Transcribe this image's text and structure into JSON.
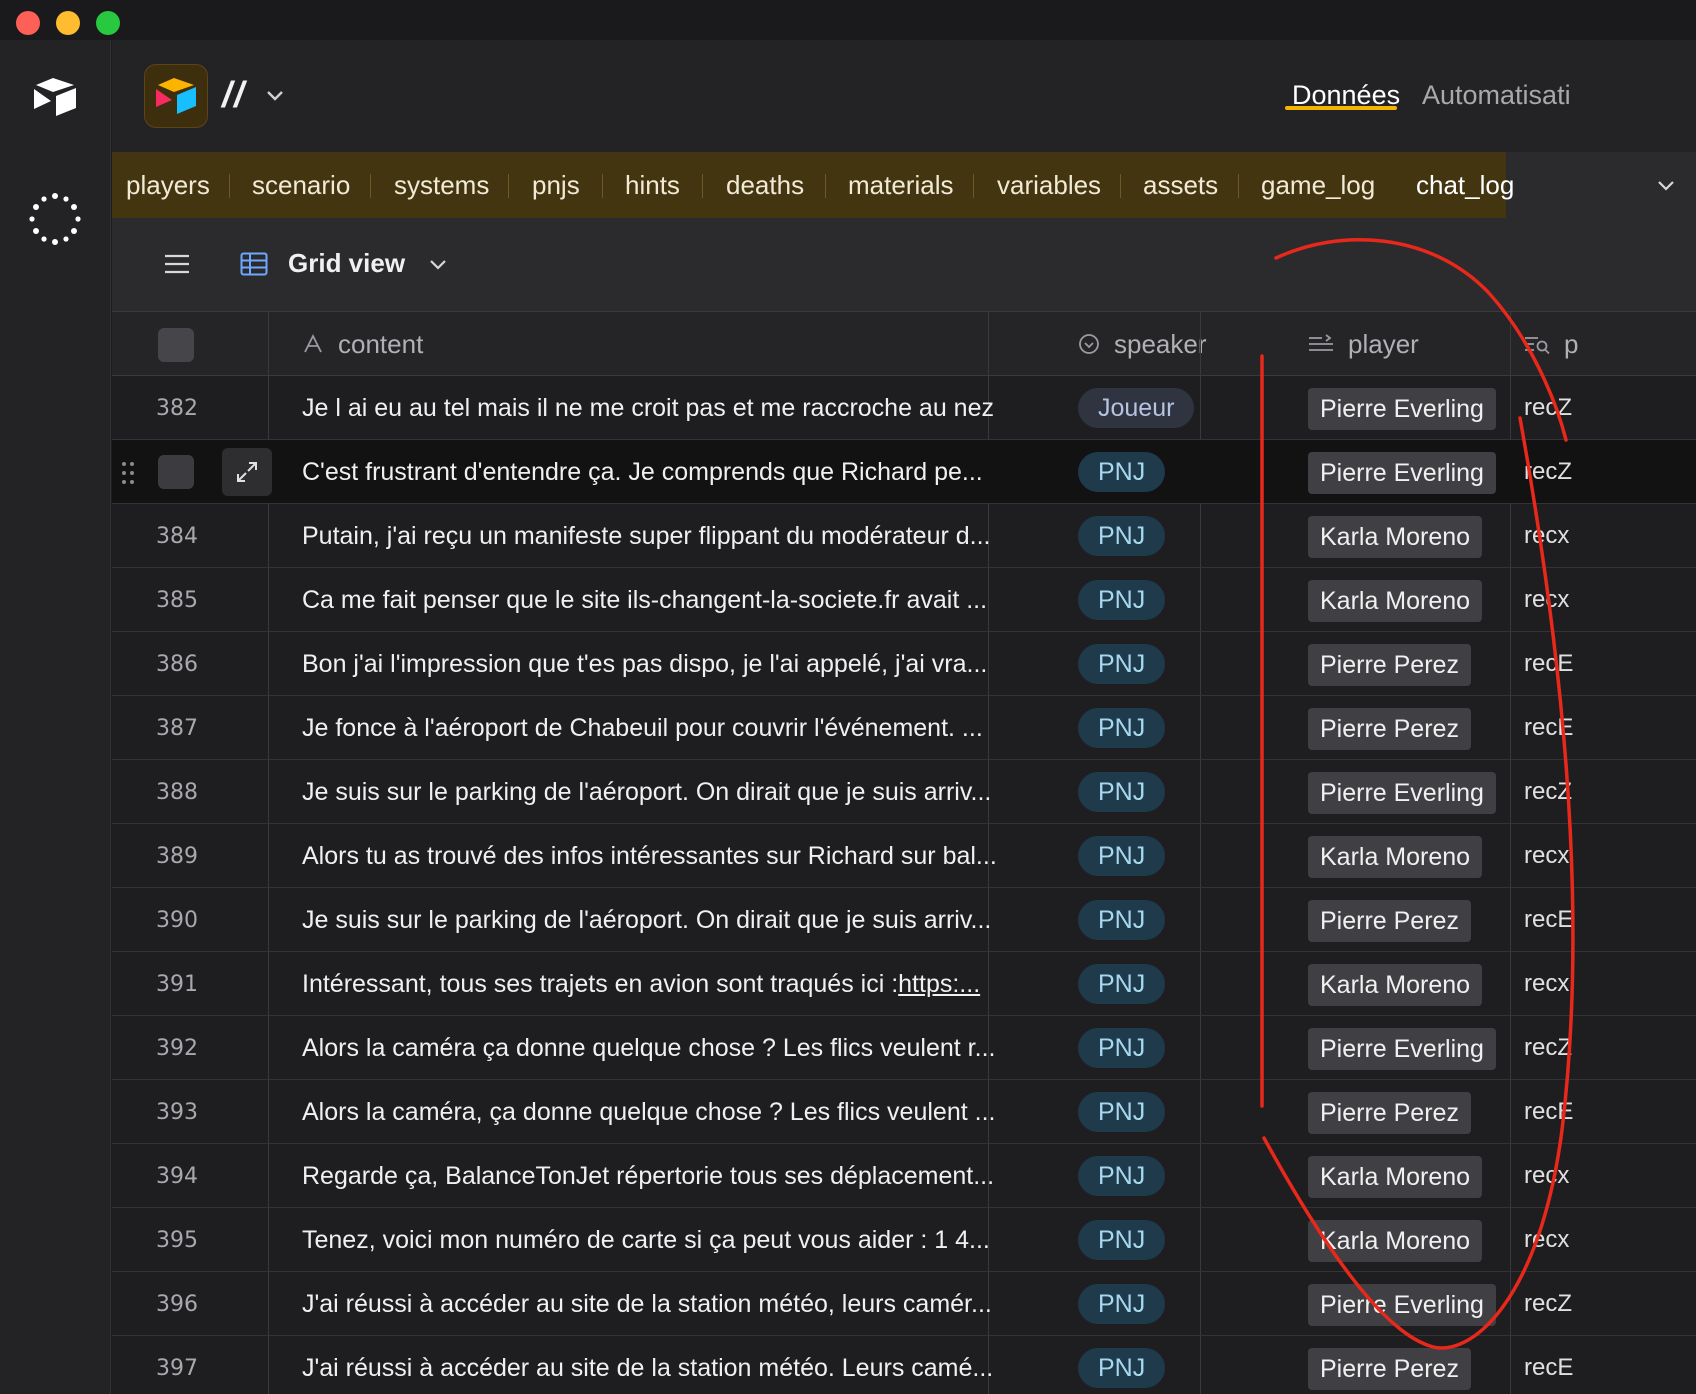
{
  "app": {
    "base_name": "//",
    "nav_tabs": [
      {
        "label": "Données",
        "active": true
      },
      {
        "label": "Automatisati",
        "active": false
      }
    ]
  },
  "tables": [
    {
      "label": "players"
    },
    {
      "label": "scenario"
    },
    {
      "label": "systems"
    },
    {
      "label": "pnjs"
    },
    {
      "label": "hints"
    },
    {
      "label": "deaths"
    },
    {
      "label": "materials"
    },
    {
      "label": "variables"
    },
    {
      "label": "assets"
    },
    {
      "label": "game_log"
    },
    {
      "label": "chat_log",
      "active": true
    }
  ],
  "view": {
    "label": "Grid view"
  },
  "columns": {
    "content": "content",
    "speaker": "speaker",
    "player": "player",
    "last": "p"
  },
  "rows": [
    {
      "num": "382",
      "content": "Je l ai eu au tel mais il ne me croit pas et me raccroche au nez",
      "speaker": "Joueur",
      "player": "Pierre Everling",
      "last": "recZ"
    },
    {
      "num": "",
      "content": "C'est frustrant d'entendre ça. Je comprends que Richard pe...",
      "speaker": "PNJ",
      "player": "Pierre Everling",
      "last": "recZ",
      "hover": true
    },
    {
      "num": "384",
      "content": "Putain, j'ai reçu un manifeste super flippant du modérateur d...",
      "speaker": "PNJ",
      "player": "Karla Moreno",
      "last": "recx"
    },
    {
      "num": "385",
      "content": "Ca me fait penser que le site ils-changent-la-societe.fr avait ...",
      "speaker": "PNJ",
      "player": "Karla Moreno",
      "last": "recx"
    },
    {
      "num": "386",
      "content": "Bon j'ai l'impression que t'es pas dispo, je l'ai appelé, j'ai vra...",
      "speaker": "PNJ",
      "player": "Pierre Perez",
      "last": "recE"
    },
    {
      "num": "387",
      "content": "Je fonce à l'aéroport de Chabeuil pour couvrir l'événement. ...",
      "speaker": "PNJ",
      "player": "Pierre Perez",
      "last": "recE"
    },
    {
      "num": "388",
      "content": "Je suis sur le parking de l'aéroport. On dirait que je suis arriv...",
      "speaker": "PNJ",
      "player": "Pierre Everling",
      "last": "recZ"
    },
    {
      "num": "389",
      "content": "Alors tu as trouvé des infos intéressantes sur Richard sur bal...",
      "speaker": "PNJ",
      "player": "Karla Moreno",
      "last": "recx"
    },
    {
      "num": "390",
      "content": "Je suis sur le parking de l'aéroport. On dirait que je suis arriv...",
      "speaker": "PNJ",
      "player": "Pierre Perez",
      "last": "recE"
    },
    {
      "num": "391",
      "content": "Intéressant, tous ses trajets en avion sont traqués ici : ",
      "link": "https:...",
      "speaker": "PNJ",
      "player": "Karla Moreno",
      "last": "recx"
    },
    {
      "num": "392",
      "content": "Alors la caméra ça donne quelque chose ? Les flics veulent r...",
      "speaker": "PNJ",
      "player": "Pierre Everling",
      "last": "recZ"
    },
    {
      "num": "393",
      "content": "Alors la caméra, ça donne quelque chose ? Les flics veulent ...",
      "speaker": "PNJ",
      "player": "Pierre Perez",
      "last": "recE"
    },
    {
      "num": "394",
      "content": "Regarde ça, BalanceTonJet répertorie tous ses déplacement...",
      "speaker": "PNJ",
      "player": "Karla Moreno",
      "last": "recx"
    },
    {
      "num": "395",
      "content": "Tenez, voici mon numéro de carte si ça peut vous aider : 1 4...",
      "speaker": "PNJ",
      "player": "Karla Moreno",
      "last": "recx"
    },
    {
      "num": "396",
      "content": "J'ai réussi à accéder au site de la station météo, leurs camér...",
      "speaker": "PNJ",
      "player": "Pierre Everling",
      "last": "recZ"
    },
    {
      "num": "397",
      "content": "J'ai réussi à accéder au site de la station météo. Leurs camé...",
      "speaker": "PNJ",
      "player": "Pierre Perez",
      "last": "recE"
    }
  ],
  "colors": {
    "accent": "#f5b400",
    "table_bar": "#43350f",
    "annotation": "#e8281a"
  }
}
